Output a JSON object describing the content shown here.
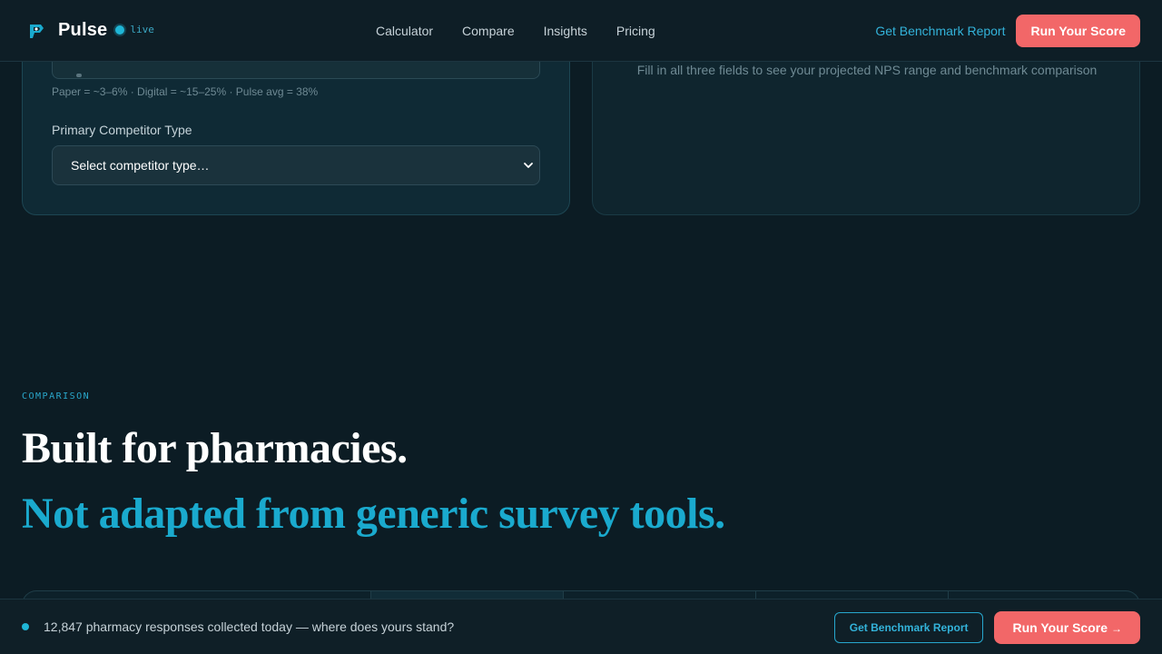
{
  "header": {
    "brand": "Pulse",
    "live_label": "live",
    "nav": [
      "Calculator",
      "Compare",
      "Insights",
      "Pricing"
    ],
    "report_link": "Get Benchmark Report",
    "cta": "Run Your Score"
  },
  "calculator": {
    "hint": "Paper = ~3–6% · Digital = ~15–25% · Pulse avg = 38%",
    "competitor_label": "Primary Competitor Type",
    "competitor_placeholder": "Select competitor type…",
    "result_hint": "Fill in all three fields to see your projected NPS range and benchmark comparison"
  },
  "comparison": {
    "eyebrow": "COMPARISON",
    "headline_1": "Built for pharmacies.",
    "headline_2": "Not adapted from generic survey tools."
  },
  "bottom_bar": {
    "message": "12,847 pharmacy responses collected today — where does yours stand?",
    "report_button": "Get Benchmark Report",
    "score_button": "Run Your Score",
    "score_arrow": "→"
  },
  "colors": {
    "background": "#0c1c24",
    "accent": "#1aaace",
    "cta": "#f26768"
  }
}
